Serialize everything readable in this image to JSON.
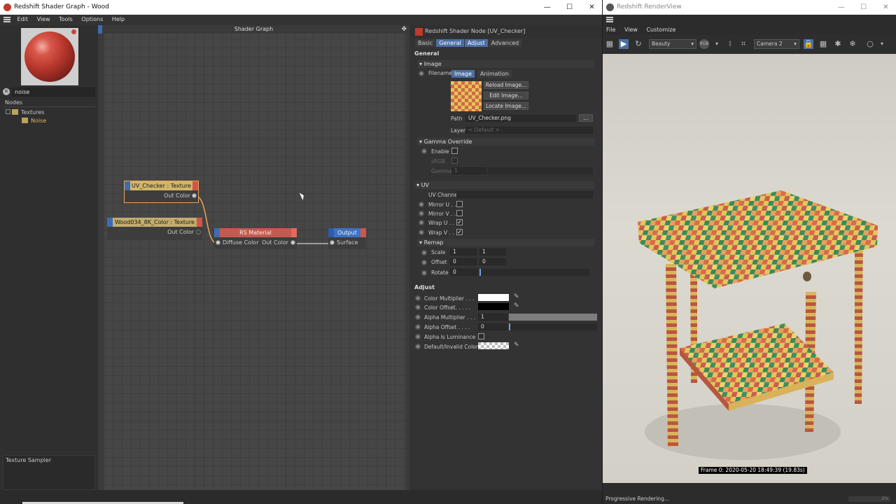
{
  "shader_window": {
    "title": "Redshift Shader Graph - Wood",
    "controls": {
      "minimize": "—",
      "maximize": "☐",
      "close": "✕"
    },
    "menu": [
      "Edit",
      "View",
      "Tools",
      "Options",
      "Help"
    ],
    "sidebar": {
      "search_value": "noise",
      "nodes_header": "Nodes",
      "tree": [
        {
          "label": "Textures",
          "expanded": true
        },
        {
          "label": "Noise"
        }
      ],
      "info_text": "Texture Sampler"
    },
    "graph": {
      "title": "Shader Graph",
      "nodes": {
        "uv_checker": {
          "title": "UV_Checker : Texture",
          "out": "Out Color"
        },
        "wood": {
          "title": "Wood034_8K_Color : Texture",
          "out": "Out Color"
        },
        "rs_material": {
          "title": "RS Material",
          "in": "Diffuse Color",
          "out": "Out Color"
        },
        "output": {
          "title": "Output",
          "in": "Surface"
        }
      }
    },
    "properties": {
      "header": "Redshift Shader Node [UV_Checker]",
      "tabs": [
        "Basic",
        "General",
        "Adjust",
        "Advanced"
      ],
      "active_tabs": [
        "General",
        "Adjust"
      ],
      "general_title": "General",
      "image_group": "Image",
      "filename_label": "Filename",
      "file_tabs": [
        "Image",
        "Animation"
      ],
      "buttons": [
        "Reload Image...",
        "Edit Image...",
        "Locate Image..."
      ],
      "path_label": "Path",
      "path_value": "UV_Checker.png",
      "browse_label": "...",
      "layer_label": "Layer",
      "layer_value": "< Default >",
      "gamma_group": "Gamma Override",
      "enable_label": "Enable",
      "srgb_label": "sRGB",
      "gamma_label": "Gamma",
      "gamma_value": "1",
      "uv_group": "UV",
      "uv_channel_label": "UV Channel",
      "mirror_u_label": "Mirror U . .",
      "mirror_v_label": "Mirror V . .",
      "wrap_u_label": "Wrap U . .",
      "wrap_v_label": "Wrap V . .",
      "remap_group": "Remap",
      "scale_label": "Scale",
      "scale_x": "1",
      "scale_y": "1",
      "offset_label": "Offset",
      "offset_x": "0",
      "offset_y": "0",
      "rotate_label": "Rotate",
      "rotate_value": "0",
      "adjust_title": "Adjust",
      "color_multiplier_label": "Color Multiplier . . .",
      "color_offset_label": "Color Offset. . . . .",
      "alpha_multiplier_label": "Alpha Multiplier . . .",
      "alpha_multiplier_value": "1",
      "alpha_offset_label": "Alpha Offset . . . .",
      "alpha_offset_value": "0",
      "alpha_luminance_label": "Alpha Is Luminance",
      "default_color_label": "Default/Invalid Color",
      "colors": {
        "color_multiplier": "#ffffff",
        "color_offset": "#000000"
      }
    }
  },
  "render_window": {
    "title": "Redshift RenderView",
    "controls": {
      "minimize": "—",
      "maximize": "☐",
      "close": "✕"
    },
    "menu": [
      "File",
      "View",
      "Customize"
    ],
    "aov_value": "Beauty",
    "camera_value": "Camera 2",
    "frame_stamp": "Frame  0:  2020-05-20  18:49:39  (19.83s)",
    "status_text": "Progressive Rendering...",
    "progress_text": "2%"
  }
}
